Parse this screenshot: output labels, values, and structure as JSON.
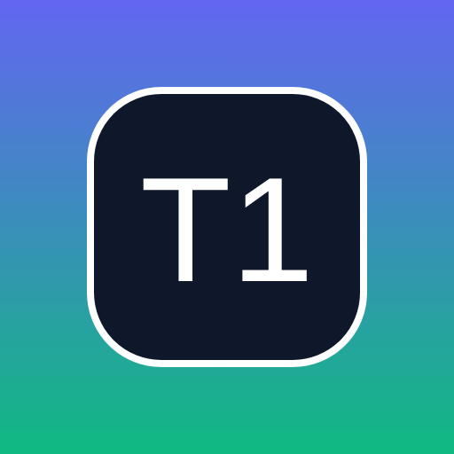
{
  "icon": {
    "label": "T1",
    "colors": {
      "gradient_top": "#6366f1",
      "gradient_bottom": "#10b981",
      "tile_fill": "#0f172a",
      "tile_border": "#ffffff",
      "text": "#ffffff"
    }
  }
}
